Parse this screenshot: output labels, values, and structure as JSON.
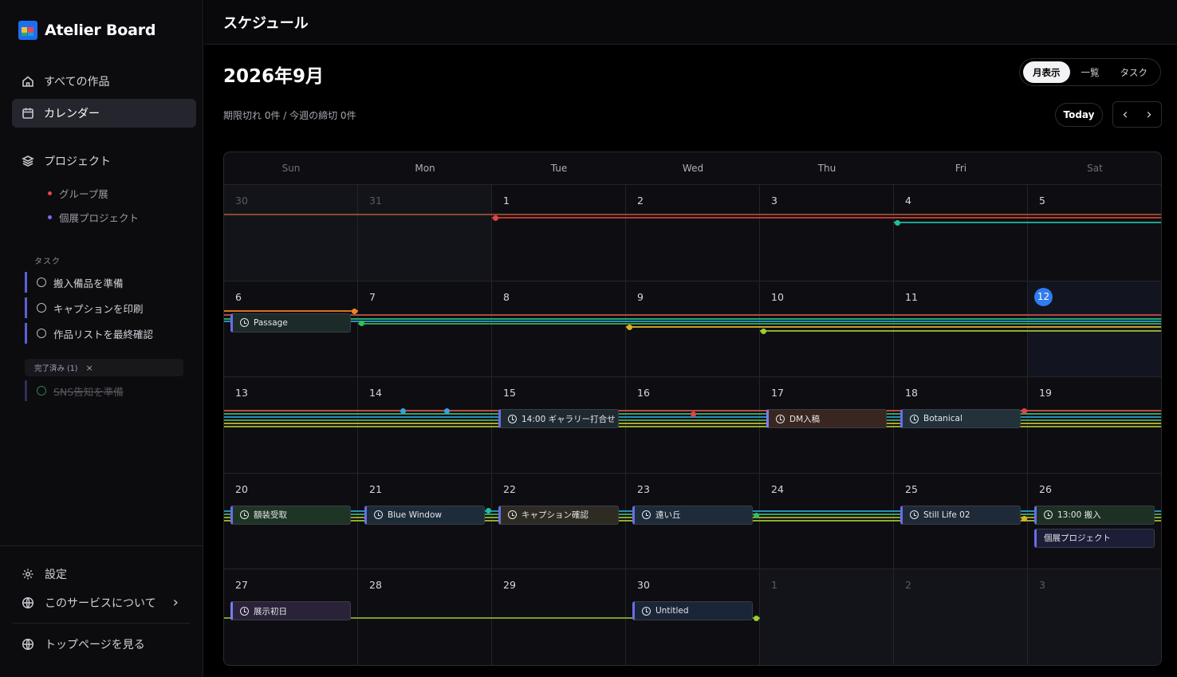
{
  "sidebar": {
    "brand": "Atelier Board",
    "nav": [
      {
        "label": "すべての作品",
        "icon": "home-icon"
      },
      {
        "label": "カレンダー",
        "icon": "calendar-icon"
      }
    ],
    "projects_label": "プロジェクト",
    "projects": [
      {
        "label": "グループ展",
        "color": "#e5484d"
      },
      {
        "label": "個展プロジェクト",
        "color": "#7c6cf2"
      }
    ],
    "tasks_label": "タスク",
    "tasks": [
      "搬入備品を準備",
      "キャプションを印刷",
      "作品リストを最終確認"
    ],
    "done_chip": "完了済み (1)",
    "done_chip_close": "×",
    "done_tasks": [
      "SNS告知を準備"
    ],
    "footer": {
      "settings": "設定",
      "about": "このサービスについて",
      "about_chevron": "›",
      "top_page": "トップページを見る"
    }
  },
  "header": {
    "title": "スケジュール"
  },
  "calendar": {
    "month_title": "2026年9月",
    "summary": "期限切れ 0件 / 今週の締切 0件",
    "views": [
      "月表示",
      "一覧",
      "タスク"
    ],
    "active_view": "月表示",
    "today_label": "Today",
    "prev": "‹",
    "next": "›",
    "weekdays": [
      "Sun",
      "Mon",
      "Tue",
      "Wed",
      "Thu",
      "Fri",
      "Sat"
    ],
    "weeks": [
      [
        "30",
        "31",
        "1",
        "2",
        "3",
        "4",
        "5"
      ],
      [
        "6",
        "7",
        "8",
        "9",
        "10",
        "11",
        "12"
      ],
      [
        "13",
        "14",
        "15",
        "16",
        "17",
        "18",
        "19"
      ],
      [
        "20",
        "21",
        "22",
        "23",
        "24",
        "25",
        "26"
      ],
      [
        "27",
        "28",
        "29",
        "30",
        "1",
        "2",
        "3"
      ]
    ],
    "today": "12",
    "events": [
      {
        "label": "Passage",
        "week": 1,
        "day": 0,
        "kind": "check",
        "bg": "#1d2a2a",
        "accent": "#6a6ce8"
      },
      {
        "label": "14:00 ギャラリー打合せ",
        "week": 2,
        "day": 2,
        "kind": "clock",
        "bg": "#1e2a30",
        "accent": "#6a6ce8"
      },
      {
        "label": "DM入稿",
        "week": 2,
        "day": 4,
        "kind": "clock",
        "bg": "#3a2620",
        "accent": "#7a7cf0"
      },
      {
        "label": "Botanical",
        "week": 2,
        "day": 5,
        "kind": "clock",
        "bg": "#22313a",
        "accent": "#6a6ce8"
      },
      {
        "label": "額装受取",
        "week": 3,
        "day": 0,
        "kind": "clock",
        "bg": "#1e3526",
        "accent": "#6a6ce8"
      },
      {
        "label": "Blue Window",
        "week": 3,
        "day": 1,
        "kind": "clock",
        "bg": "#1d2c3a",
        "accent": "#6a6ce8"
      },
      {
        "label": "キャプション確認",
        "week": 3,
        "day": 2,
        "kind": "clock",
        "bg": "#2e2c22",
        "accent": "#6a6ce8"
      },
      {
        "label": "遠い丘",
        "week": 3,
        "day": 3,
        "kind": "clock",
        "bg": "#1d2b3a",
        "accent": "#6a6ce8"
      },
      {
        "label": "Still Life 02",
        "week": 3,
        "day": 5,
        "kind": "clock",
        "bg": "#1f2a38",
        "accent": "#6a6ce8"
      },
      {
        "label": "13:00 搬入",
        "week": 3,
        "day": 6,
        "kind": "clock",
        "bg": "#1c3024",
        "accent": "#6a6ce8"
      },
      {
        "label": "個展プロジェクト",
        "week": 3,
        "day": 6,
        "slot": 1,
        "kind": "none",
        "bg": "#1c1d36",
        "accent": "#6a6ce8"
      },
      {
        "label": "展示初日",
        "week": 4,
        "day": 0,
        "kind": "clock",
        "bg": "#2a2238",
        "accent": "#7a7cf0"
      },
      {
        "label": "Untitled",
        "week": 4,
        "day": 3,
        "kind": "clock",
        "bg": "#1a2538",
        "accent": "#6a6ce8"
      }
    ]
  }
}
